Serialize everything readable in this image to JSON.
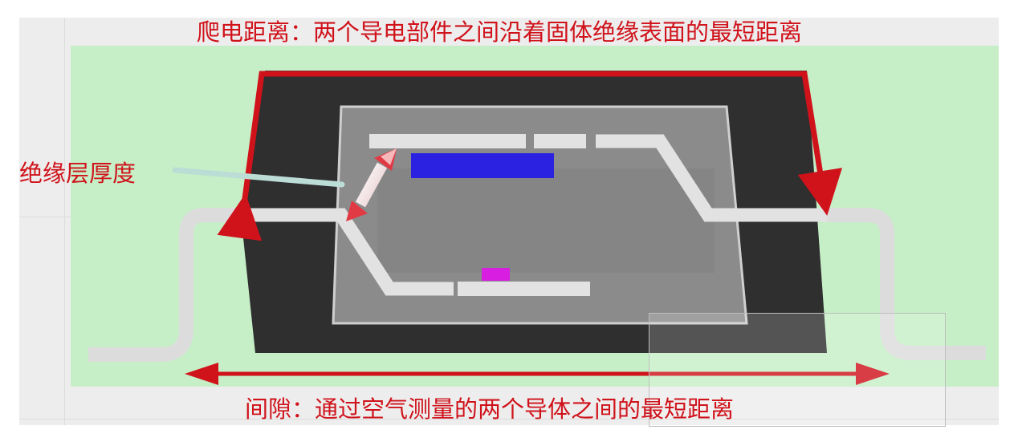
{
  "labels": {
    "creepage": "爬电距离：两个导电部件之间沿着固体绝缘表面的最短距离",
    "insulation_thickness": "绝缘层厚度",
    "clearance": "间隙：通过空气测量的两个导体之间的最短距离"
  },
  "colors": {
    "annotation_red": "#d0121b",
    "background_green": "#c6efc7",
    "package_body": "#2f2f2f",
    "die_cavity": "#8a8a8a",
    "lead_frame": "#e8e8e8",
    "chip_blue": "#2a22e0",
    "chip_magenta": "#d81ee0"
  }
}
